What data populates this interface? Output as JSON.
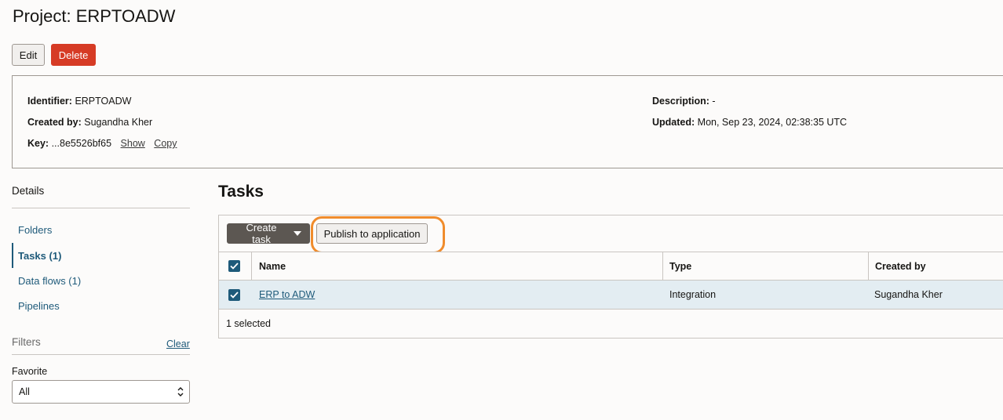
{
  "header": {
    "title": "Project: ERPTOADW"
  },
  "actions": {
    "edit_label": "Edit",
    "delete_label": "Delete"
  },
  "info": {
    "identifier_label": "Identifier:",
    "identifier_value": "ERPTOADW",
    "created_by_label": "Created by:",
    "created_by_value": "Sugandha Kher",
    "key_label": "Key:",
    "key_value": "...8e5526bf65",
    "show_label": "Show",
    "copy_label": "Copy",
    "description_label": "Description:",
    "description_value": "-",
    "updated_label": "Updated:",
    "updated_value": "Mon, Sep 23, 2024, 02:38:35 UTC"
  },
  "sidebar": {
    "heading": "Details",
    "items": [
      {
        "label": "Folders"
      },
      {
        "label": "Tasks (1)"
      },
      {
        "label": "Data flows (1)"
      },
      {
        "label": "Pipelines"
      }
    ],
    "active_index": 1
  },
  "filters": {
    "heading": "Filters",
    "clear_label": "Clear",
    "favorite_label": "Favorite",
    "favorite_selected": "All"
  },
  "tasks": {
    "title": "Tasks",
    "create_task_label": "Create task",
    "publish_label": "Publish to application",
    "columns": [
      "Name",
      "Type",
      "Created by"
    ],
    "rows": [
      {
        "name": "ERP to ADW",
        "type": "Integration",
        "created_by": "Sugandha Kher",
        "selected": true
      }
    ],
    "selected_summary": "1 selected"
  },
  "colors": {
    "accent": "#1e5a7a",
    "danger": "#d63b25",
    "highlight": "#f08c2c",
    "selected_row": "#e3edf2"
  }
}
